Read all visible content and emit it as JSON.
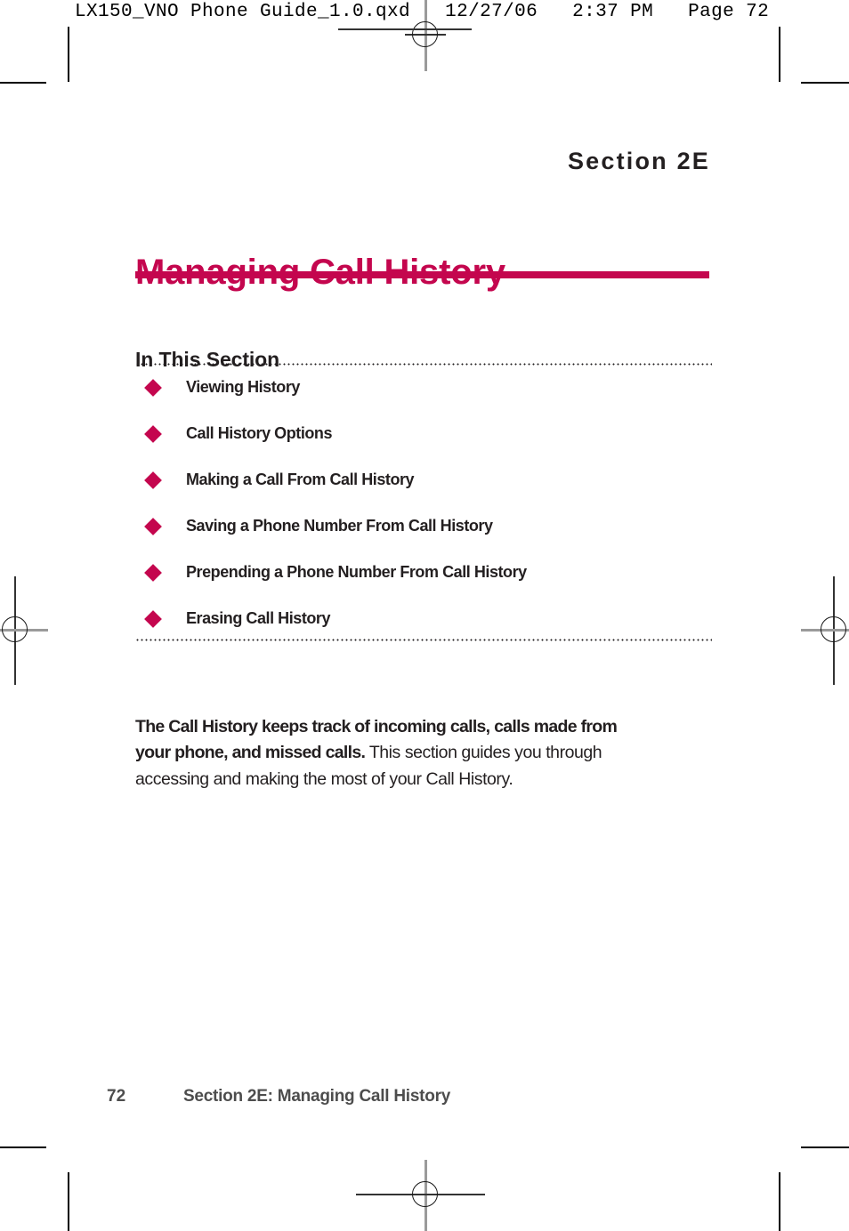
{
  "prepress": {
    "slug": "LX150_VNO Phone Guide_1.0.qxd   12/27/06   2:37 PM   Page 72"
  },
  "page": {
    "section_label": "Section 2E",
    "title": "Managing Call History",
    "accent_color": "#c4064e",
    "text_color": "#231f20",
    "in_this_section_heading": "In This Section",
    "toc": [
      {
        "label": "Viewing History"
      },
      {
        "label": "Call History Options"
      },
      {
        "label": "Making a Call From Call History"
      },
      {
        "label": "Saving a Phone Number From Call History"
      },
      {
        "label": "Prepending a Phone Number From Call History"
      },
      {
        "label": "Erasing Call History"
      }
    ],
    "intro": {
      "lead": "The Call History keeps track of incoming calls, calls made from your phone, and missed calls.",
      "rest": " This section guides you through accessing and making the most of your Call History."
    },
    "footer": {
      "page_number": "72",
      "running_title": "Section 2E: Managing Call History"
    }
  }
}
